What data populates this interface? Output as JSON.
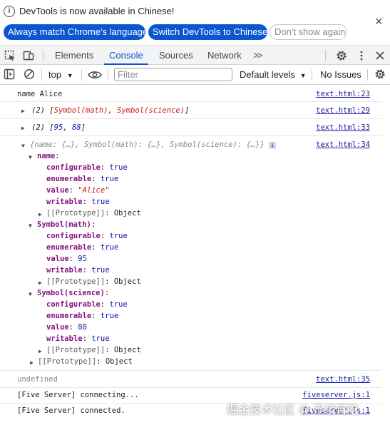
{
  "infobar": {
    "message": "DevTools is now available in Chinese!",
    "buttons": [
      "Always match Chrome's language",
      "Switch DevTools to Chinese",
      "Don't show again"
    ],
    "close": "×"
  },
  "tabs": {
    "items": [
      "Elements",
      "Console",
      "Sources",
      "Network"
    ],
    "active": "Console",
    "more": ">>",
    "accent": "#0b57d0"
  },
  "toolbar": {
    "context": "top",
    "filter_placeholder": "Filter",
    "levels": "Default levels",
    "issues": "No Issues"
  },
  "console": {
    "row1": {
      "text": "name Alice",
      "link": "text.html:23"
    },
    "row2": {
      "count": "(2)",
      "items": [
        "Symbol(math)",
        "Symbol(science)"
      ],
      "link": "text.html:29"
    },
    "row3": {
      "count": "(2)",
      "items": [
        "95",
        "88"
      ],
      "link": "text.html:33"
    },
    "row4": {
      "preview": "{name: {…}, Symbol(math): {…}, Symbol(science): {…}}",
      "badge": "i",
      "link": "text.html:34",
      "groups": [
        {
          "key": "name",
          "props": [
            {
              "k": "configurable",
              "v": "true"
            },
            {
              "k": "enumerable",
              "v": "true"
            },
            {
              "k": "value",
              "v": "\"Alice\""
            },
            {
              "k": "writable",
              "v": "true"
            }
          ]
        },
        {
          "key": "Symbol(math)",
          "props": [
            {
              "k": "configurable",
              "v": "true"
            },
            {
              "k": "enumerable",
              "v": "true"
            },
            {
              "k": "value",
              "v": "95"
            },
            {
              "k": "writable",
              "v": "true"
            }
          ]
        },
        {
          "key": "Symbol(science)",
          "props": [
            {
              "k": "configurable",
              "v": "true"
            },
            {
              "k": "enumerable",
              "v": "true"
            },
            {
              "k": "value",
              "v": "88"
            },
            {
              "k": "writable",
              "v": "true"
            }
          ]
        }
      ],
      "proto_label": "[[Prototype]]",
      "proto_value": "Object"
    },
    "row5": {
      "text": "undefined",
      "link": "text.html:35"
    },
    "row6": {
      "text": "[Five Server] connecting...",
      "link": "fiveserver.js:1"
    },
    "row7": {
      "text": "[Five Server] connected.",
      "link": "fiveserver.js:1"
    }
  },
  "watermark": "掘金技术社区 @ 不夜宵吃"
}
